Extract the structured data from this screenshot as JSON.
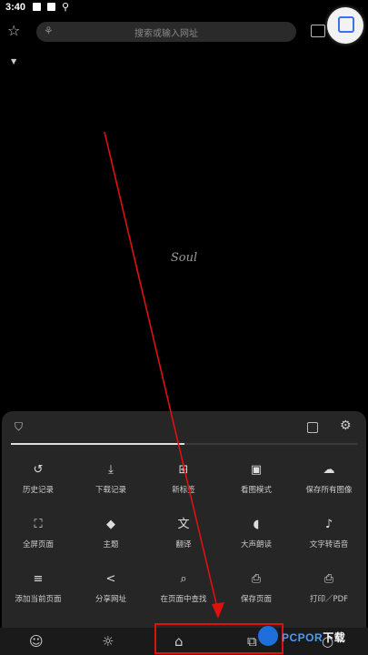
{
  "status_bar": {
    "time": "3:40"
  },
  "top_bar": {
    "search_placeholder": "搜索或输入网址",
    "star_icon": "star-outline",
    "tabs_icon": "tabs"
  },
  "content": {
    "page_text": "Soul"
  },
  "menu_sheet": {
    "progress": 0.5,
    "rows": [
      [
        {
          "icon": "↺",
          "label": "历史记录"
        },
        {
          "icon": "⤓",
          "label": "下载记录"
        },
        {
          "icon": "⊞",
          "label": "新标签"
        },
        {
          "icon": "▣",
          "label": "看图模式"
        },
        {
          "icon": "☁",
          "label": "保存所有图像"
        }
      ],
      [
        {
          "icon": "⛶",
          "label": "全屏页面"
        },
        {
          "icon": "◆",
          "label": "主题"
        },
        {
          "icon": "文",
          "label": "翻译"
        },
        {
          "icon": "◖",
          "label": "大声朗读"
        },
        {
          "icon": "♪",
          "label": "文字转语音"
        }
      ],
      [
        {
          "icon": "≡",
          "label": "添加当前页面"
        },
        {
          "icon": "<",
          "label": "分享网址"
        },
        {
          "icon": "⌕",
          "label": "在页面中查找"
        },
        {
          "icon": "⎙",
          "label": "保存页面"
        },
        {
          "icon": "⎙",
          "label": "打印／PDF"
        }
      ]
    ]
  },
  "bottom_bar": {
    "items": [
      "☺",
      "☼",
      "⌂",
      "⧉",
      "○"
    ]
  },
  "watermark": {
    "text_a": "PCPOR",
    "text_b": "下载"
  },
  "colors": {
    "annotation_red": "#e01010",
    "background": "#000000",
    "sheet": "#262626"
  }
}
